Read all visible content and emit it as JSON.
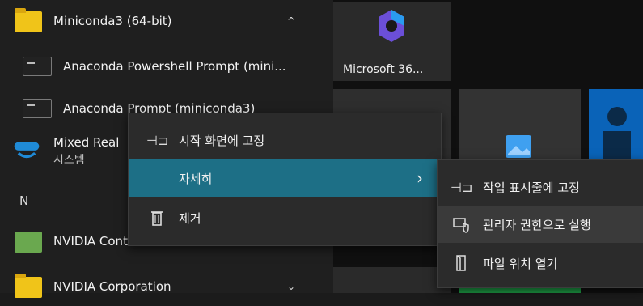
{
  "app_list": {
    "items": [
      {
        "label": "Miniconda3 (64-bit)",
        "chevron": "^",
        "icon": "folder-icon"
      },
      {
        "label": "Anaconda Powershell Prompt (mini...",
        "icon": "terminal-icon"
      },
      {
        "label": "Anaconda Prompt (miniconda3)",
        "icon": "terminal-icon"
      },
      {
        "label": "Mixed Real",
        "sublabel": "시스템",
        "icon": "mixed-reality-icon"
      },
      {
        "letter": "N"
      },
      {
        "label": "NVIDIA Control Panel",
        "icon": "nvidia-icon"
      },
      {
        "label": "NVIDIA Corporation",
        "chevron": "⌄",
        "icon": "folder-icon"
      }
    ]
  },
  "tiles": {
    "microsoft365_label": "Microsoft 36..."
  },
  "context_menu": {
    "items": [
      {
        "label": "시작 화면에 고정",
        "icon": "pin-icon"
      },
      {
        "label": "자세히",
        "arrow": "›"
      },
      {
        "label": "제거",
        "icon": "trash-icon"
      }
    ]
  },
  "submenu": {
    "items": [
      {
        "label": "작업 표시줄에 고정",
        "icon": "pin-icon"
      },
      {
        "label": "관리자 권한으로 실행",
        "icon": "shield-icon"
      },
      {
        "label": "파일 위치 열기",
        "icon": "file-icon"
      }
    ]
  },
  "colors": {
    "accent": "#1d6f86",
    "menu_bg": "#2b2b2b",
    "hover_bg": "#3a3a3a"
  }
}
